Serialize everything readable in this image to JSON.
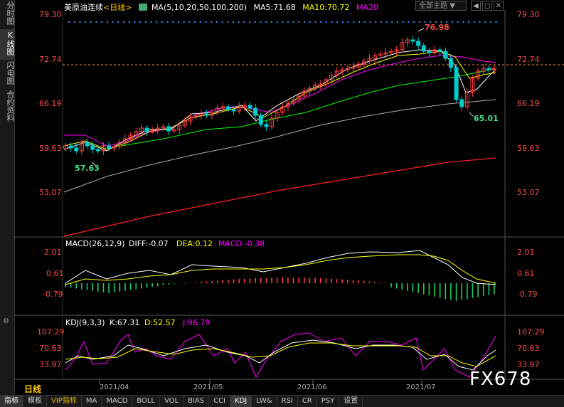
{
  "sidebar": {
    "items": [
      {
        "label": "分时图",
        "active": false
      },
      {
        "label": "K线图",
        "active": true
      },
      {
        "label": "闪电图",
        "active": false
      },
      {
        "label": "合约资料",
        "active": false
      }
    ]
  },
  "header": {
    "instrument": "美原油连续",
    "period": "<日线>",
    "ma_label": "MA(5,10,20,50,100,200)",
    "ma5": "MA5:71.68",
    "ma10": "MA10:70.72",
    "ma20": "MA20",
    "theme_select": "全部主题",
    "btn_minimize": "◀",
    "btn_restore": "◻",
    "btn_close": "✕"
  },
  "price_axis": {
    "left": [
      "79.30",
      "72.74",
      "66.19",
      "59.63",
      "53.07"
    ],
    "right": [
      "79.30",
      "72.74",
      "66.19",
      "59.63",
      "53.07"
    ]
  },
  "annotations": {
    "high": "76.98",
    "low1": "57.63",
    "low2": "65.01"
  },
  "macd": {
    "title": "MACD(26,12,9)",
    "diff": "DIFF:-0.07",
    "dea": "DEA:0.12",
    "macd": "MACD:-0.38",
    "axis": [
      "2.01",
      "0.61",
      "-0.79"
    ]
  },
  "kdj": {
    "title": "KDJ(9,3,3)",
    "k": "K:67.31",
    "d": "D:52.57",
    "j": "J:96.79",
    "axis": [
      "107.29",
      "70.63",
      "33.97"
    ]
  },
  "dates": [
    "2021/04",
    "2021/05",
    "2021/06",
    "2021/07"
  ],
  "period_label": "日线",
  "watermark": "FX678",
  "bottom_tabs": [
    "指标",
    "模板",
    "VIP指标",
    "MA",
    "MACD",
    "BOLL",
    "VOL",
    "BIAS",
    "CCI",
    "KDJ",
    "LW&",
    "RSI",
    "CR",
    "PSY",
    "设置"
  ],
  "colors": {
    "up": "#ff4040",
    "down": "#00cccc",
    "ma5": "#ffffff",
    "ma10": "#ffff00",
    "ma20": "#ff00ff",
    "ma50": "#00ff00",
    "ma100": "#aaaaaa",
    "ma200": "#ff2020",
    "axis_text": "#ff4a4a"
  }
}
